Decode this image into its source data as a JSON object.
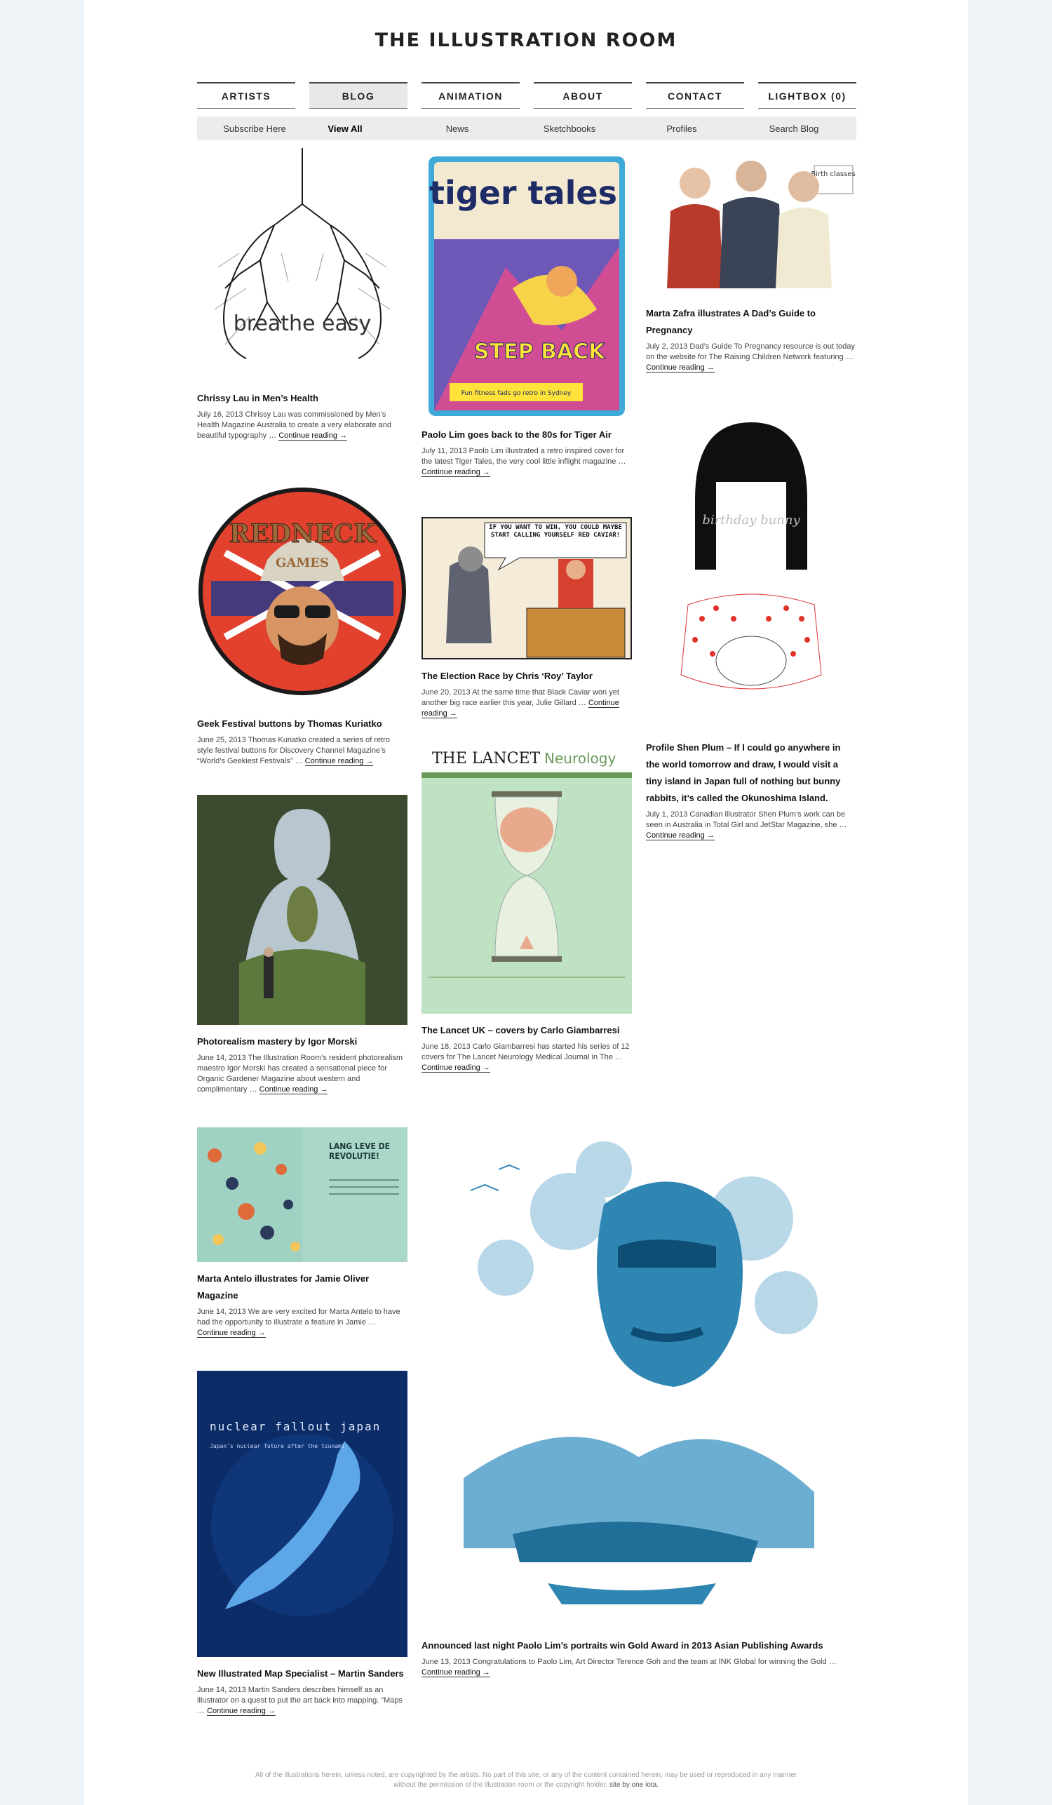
{
  "site": {
    "title": "THE ILLUSTRATION ROOM"
  },
  "nav": [
    "ARTISTS",
    "BLOG",
    "ANIMATION",
    "ABOUT",
    "CONTACT",
    "LIGHTBOX (0)"
  ],
  "subnav": [
    "Subscribe Here",
    "View All",
    "News",
    "Sketchbooks",
    "Profiles",
    "Search Blog"
  ],
  "continue_label": "Continue reading →",
  "posts": [
    {
      "title": "Chrissy Lau in Men’s Health",
      "excerpt": "July 16, 2013  Chrissy Lau was commissioned by Men’s Health Magazine Australia to create a very elaborate and beautiful typography …",
      "image_text": "breathe easy"
    },
    {
      "title": "Paolo Lim goes back to the 80s for Tiger Air",
      "excerpt": "July 11, 2013 Paolo Lim illustrated a retro inspired cover for the latest Tiger Tales, the very cool little inflight magazine …",
      "image_text": "tiger tales",
      "image_text_2": "STEP BACK",
      "image_text_3": "Fun fitness fads go retro in Sydney"
    },
    {
      "title": "Marta Zafra illustrates A Dad’s Guide to Pregnancy",
      "excerpt": "July 2, 2013 Dad’s Guide To Pregnancy resource is out today on the website for The Raising Children Network featuring …",
      "image_text": "Birth classes"
    },
    {
      "title": "Geek Festival buttons by Thomas Kuriatko",
      "excerpt": "June 25, 2013 Thomas Kuriatko created a series of retro style festival buttons for Discovery Channel Magazine’s “World’s Geekiest Festivals” …",
      "image_text": "REDNECK",
      "image_text_2": "GAMES"
    },
    {
      "title": "The Election Race by Chris ‘Roy’ Taylor",
      "excerpt": "June 20, 2013 At the same time that Black Caviar won yet another big race earlier this year, Julie Gillard …",
      "image_text": "IF YOU WANT TO WIN, YOU COULD MAYBE START CALLING YOURSELF RED CAVIAR!"
    },
    {
      "title": "Profile Shen Plum – If I could go anywhere in the world tomorrow and draw, I would visit a tiny island in Japan full of nothing but bunny rabbits, it’s called the Okunoshima Island.",
      "excerpt": "July 1, 2013 Canadian illustrator Shen Plum’s work can be seen in Australia in Total Girl and JetStar Magazine, she …",
      "image_text": "birthday bunny"
    },
    {
      "title": "Photorealism mastery by Igor Morski",
      "excerpt": "June 14, 2013 The Illustration Room’s resident photorealism maestro Igor Morski has created a sensational piece for Organic Gardener Magazine about western and complimentary …"
    },
    {
      "title": "The Lancet UK – covers by Carlo Giambarresi",
      "excerpt": "June 18, 2013 Carlo Giambarresi has started his series of 12 covers for The Lancet Neurology Medical Journal in The …",
      "image_text": "THE LANCET",
      "image_text_2": "Neurology"
    },
    {
      "title": "Marta Antelo illustrates for Jamie Oliver Magazine",
      "excerpt": "June 14, 2013 We are very excited for Marta Antelo to have had the opportunity to illustrate a feature in Jamie …",
      "image_text": "LANG LEVE DE REVOLUTIE!"
    },
    {
      "title": "New Illustrated Map Specialist – Martin Sanders",
      "excerpt": "June 14, 2013 Martin Sanders describes himself as an illustrator on a quest to put the art back into mapping. “Maps …",
      "image_text": "nuclear fallout japan",
      "image_text_2": "Japan's nuclear future after the tsunami"
    },
    {
      "title": "Announced last night Paolo Lim’s portraits win Gold Award in 2013 Asian Publishing Awards",
      "excerpt": "June 13, 2013  Congratulations to Paolo Lim, Art Director Terence Goh and the team at INK Global for winning the Gold …"
    }
  ],
  "footer": {
    "line1": "All of the illustrations herein, unless noted, are copyrighted by the artists. No part of this site, or any of the content contained herein, may be used or reproduced in any manner",
    "line2": "without the permission of the illustration room or the copyright holder.",
    "siteby": "site by one iota."
  },
  "colors": {
    "background": "#eef3f8",
    "page": "#ffffff",
    "text": "#1a1a1a",
    "nav_border": "#444444",
    "subnav_bg": "#ececec"
  }
}
